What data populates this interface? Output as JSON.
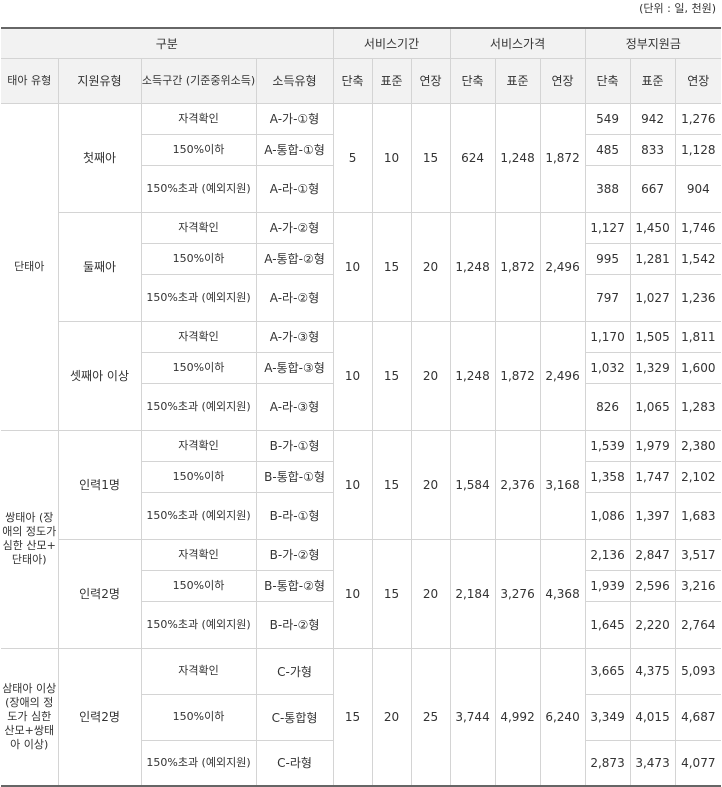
{
  "unit_note": "(단위 : 일, 천원)",
  "headers": {
    "group": "구분",
    "service_period": "서비스기간",
    "service_price": "서비스가격",
    "gov_support": "정부지원금",
    "fetus_type": "태아 유형",
    "support_type": "지원유형",
    "income_range": "소득구간 (기준중위소득)",
    "income_type": "소득유형",
    "short": "단축",
    "standard": "표준",
    "extended": "연장"
  },
  "rows": [
    {
      "fetus": "단태아",
      "support": "첫째아",
      "income": "자격확인",
      "type": "A-가-①형",
      "period": [
        "5",
        "10",
        "15"
      ],
      "price": [
        "624",
        "1,248",
        "1,872"
      ],
      "gov": [
        "549",
        "942",
        "1,276"
      ]
    },
    {
      "income": "150%이하",
      "type": "A-통합-①형",
      "gov": [
        "485",
        "833",
        "1,128"
      ]
    },
    {
      "income": "150%초과 (예외지원)",
      "type": "A-라-①형",
      "gov": [
        "388",
        "667",
        "904"
      ]
    },
    {
      "support": "둘째아",
      "income": "자격확인",
      "type": "A-가-②형",
      "period": [
        "10",
        "15",
        "20"
      ],
      "price": [
        "1,248",
        "1,872",
        "2,496"
      ],
      "gov": [
        "1,127",
        "1,450",
        "1,746"
      ]
    },
    {
      "income": "150%이하",
      "type": "A-통합-②형",
      "gov": [
        "995",
        "1,281",
        "1,542"
      ]
    },
    {
      "income": "150%초과 (예외지원)",
      "type": "A-라-②형",
      "gov": [
        "797",
        "1,027",
        "1,236"
      ]
    },
    {
      "support": "셋째아 이상",
      "income": "자격확인",
      "type": "A-가-③형",
      "period": [
        "10",
        "15",
        "20"
      ],
      "price": [
        "1,248",
        "1,872",
        "2,496"
      ],
      "gov": [
        "1,170",
        "1,505",
        "1,811"
      ]
    },
    {
      "income": "150%이하",
      "type": "A-통합-③형",
      "gov": [
        "1,032",
        "1,329",
        "1,600"
      ]
    },
    {
      "income": "150%초과 (예외지원)",
      "type": "A-라-③형",
      "gov": [
        "826",
        "1,065",
        "1,283"
      ]
    },
    {
      "fetus": "쌍태아 (장애의 정도가 심한 산모+ 단태아)",
      "support": "인력1명",
      "income": "자격확인",
      "type": "B-가-①형",
      "period": [
        "10",
        "15",
        "20"
      ],
      "price": [
        "1,584",
        "2,376",
        "3,168"
      ],
      "gov": [
        "1,539",
        "1,979",
        "2,380"
      ]
    },
    {
      "income": "150%이하",
      "type": "B-통합-①형",
      "gov": [
        "1,358",
        "1,747",
        "2,102"
      ]
    },
    {
      "income": "150%초과 (예외지원)",
      "type": "B-라-①형",
      "gov": [
        "1,086",
        "1,397",
        "1,683"
      ]
    },
    {
      "support": "인력2명",
      "income": "자격확인",
      "type": "B-가-②형",
      "period": [
        "10",
        "15",
        "20"
      ],
      "price": [
        "2,184",
        "3,276",
        "4,368"
      ],
      "gov": [
        "2,136",
        "2,847",
        "3,517"
      ]
    },
    {
      "income": "150%이하",
      "type": "B-통합-②형",
      "gov": [
        "1,939",
        "2,596",
        "3,216"
      ]
    },
    {
      "income": "150%초과 (예외지원)",
      "type": "B-라-②형",
      "gov": [
        "1,645",
        "2,220",
        "2,764"
      ]
    },
    {
      "fetus": "삼태아 이상 (장애의 정도가 심한 산모+쌍태아 이상)",
      "support": "인력2명",
      "income": "자격확인",
      "type": "C-가형",
      "period": [
        "15",
        "20",
        "25"
      ],
      "price": [
        "3,744",
        "4,992",
        "6,240"
      ],
      "gov": [
        "3,665",
        "4,375",
        "5,093"
      ]
    },
    {
      "income": "150%이하",
      "type": "C-통합형",
      "gov": [
        "3,349",
        "4,015",
        "4,687"
      ]
    },
    {
      "income": "150%초과 (예외지원)",
      "type": "C-라형",
      "gov": [
        "2,873",
        "3,473",
        "4,077"
      ]
    }
  ]
}
